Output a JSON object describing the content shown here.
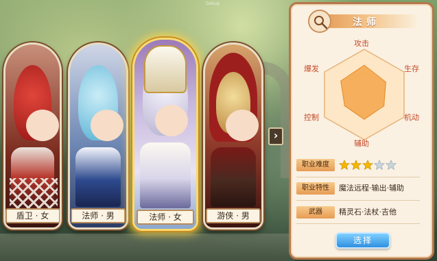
{
  "debug_label": "Debug",
  "cards": [
    {
      "name": "盾卫 · 女"
    },
    {
      "name": "法师 · 男"
    },
    {
      "name": "法师 · 女"
    },
    {
      "name": "游侠 · 男"
    }
  ],
  "selected_card_index": 2,
  "panel": {
    "class_name": "法师",
    "class_icon": "mage-staff-icon",
    "radar": {
      "labels": {
        "attack": "攻击",
        "survive": "生存",
        "mobility": "机动",
        "support": "辅助",
        "control": "控制",
        "burst": "爆发"
      },
      "values": {
        "attack": 0.65,
        "survive": 0.55,
        "mobility": 0.5,
        "support": 0.55,
        "control": 0.5,
        "burst": 0.6
      }
    },
    "difficulty_label": "职业难度",
    "difficulty_stars": 3,
    "difficulty_max": 5,
    "trait_label": "职业特性",
    "trait_value": "魔法远程·输出·辅助",
    "weapon_label": "武器",
    "weapon_value": "精灵石·法杖·吉他",
    "select_label": "选择"
  },
  "colors": {
    "panel_border": "#b5774a",
    "accent_orange": "#e79c55",
    "radar_fill": "#f4a64a",
    "star_on": "#f5b700",
    "star_off": "#c9d4dc",
    "button_blue": "#2f8fe0"
  }
}
